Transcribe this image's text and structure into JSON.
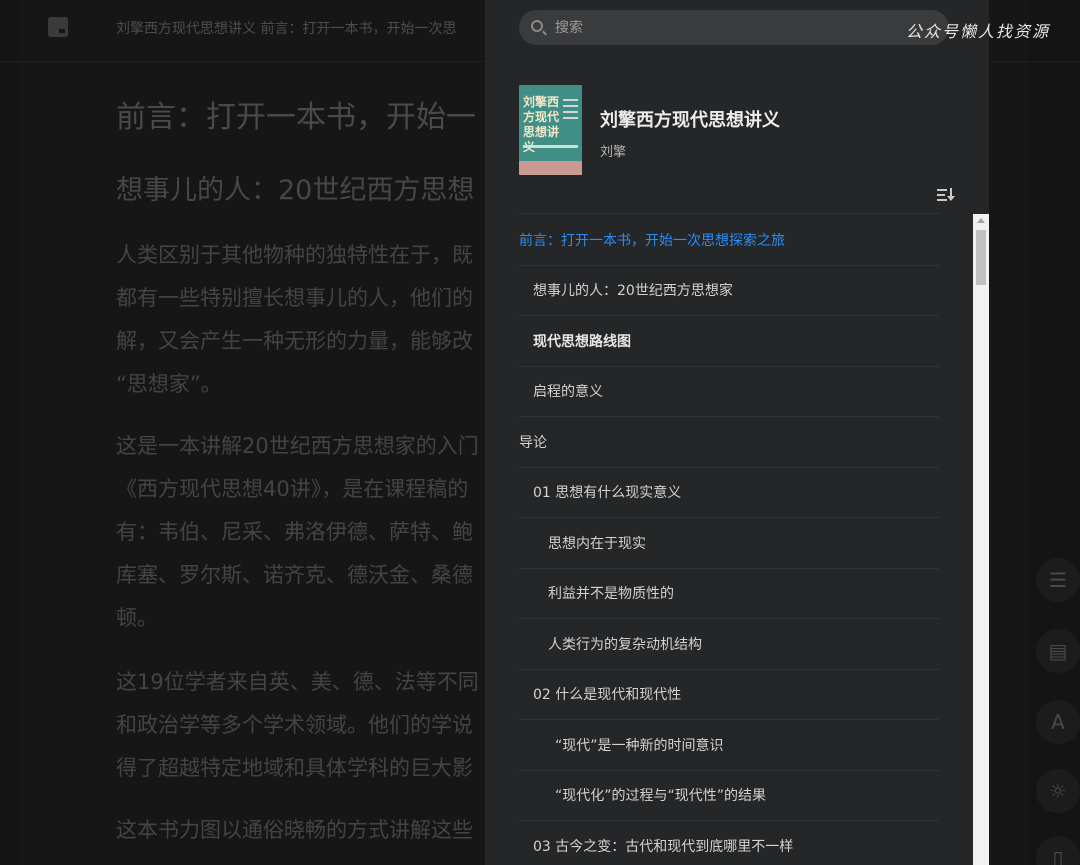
{
  "reader": {
    "top_title": "刘擎西方现代思想讲义 前言：打开一本书，开始一次思",
    "heading": "前言：打开一本书，开始一",
    "subheading": "想事儿的人：20世纪西方思想",
    "paragraphs": [
      [
        "人类区别于其他物种的独特性在于，既",
        "都有一些特别擅长想事儿的人，他们的",
        "解，又会产生一种无形的力量，能够改",
        "“思想家”。"
      ],
      [
        "这是一本讲解20世纪西方思想家的入门",
        "《西方现代思想40讲》，是在课程稿的",
        "有：韦伯、尼采、弗洛伊德、萨特、鲍",
        "库塞、罗尔斯、诺齐克、德沃金、桑德",
        "顿。"
      ],
      [
        "这19位学者来自英、美、德、法等不同",
        "和政治学等多个学术领域。他们的学说",
        "得了超越特定地域和具体学科的巨大影"
      ],
      [
        "这本书力图以通俗晓畅的方式讲解这些"
      ]
    ]
  },
  "tools": {
    "toc_glyph": "☰",
    "comment_glyph": "▤",
    "font_glyph": "A",
    "brightness_glyph": "☼",
    "bookmark_glyph": "▯"
  },
  "drawer": {
    "search_placeholder": "搜索",
    "book": {
      "cover_title": "刘擎西方现代思想讲义",
      "title": "刘擎西方现代思想讲义",
      "author": "刘擎"
    },
    "toc": [
      {
        "label": "前言：打开一本书，开始一次思想探索之旅",
        "level": 0,
        "active": true
      },
      {
        "label": "想事儿的人：20世纪西方思想家",
        "level": 1
      },
      {
        "label": "现代思想路线图",
        "level": 1,
        "bold": true
      },
      {
        "label": "启程的意义",
        "level": 1
      },
      {
        "label": "导论",
        "level": 0
      },
      {
        "label": "01 思想有什么现实意义",
        "level": 1
      },
      {
        "label": "思想内在于现实",
        "level": 2
      },
      {
        "label": "利益并不是物质性的",
        "level": 2
      },
      {
        "label": "人类行为的复杂动机结构",
        "level": 2
      },
      {
        "label": "02 什么是现代和现代性",
        "level": 1
      },
      {
        "label": "“现代”是一种新的时间意识",
        "level": 3
      },
      {
        "label": "“现代化”的过程与“现代性”的结果",
        "level": 3
      },
      {
        "label": "03 古今之变：古代和现代到底哪里不一样",
        "level": 1
      }
    ]
  },
  "watermark": "公众号懒人找资源",
  "colors": {
    "active_link": "#2d8cf0",
    "drawer_bg": "#252627",
    "cover_green": "#3f8f86"
  }
}
